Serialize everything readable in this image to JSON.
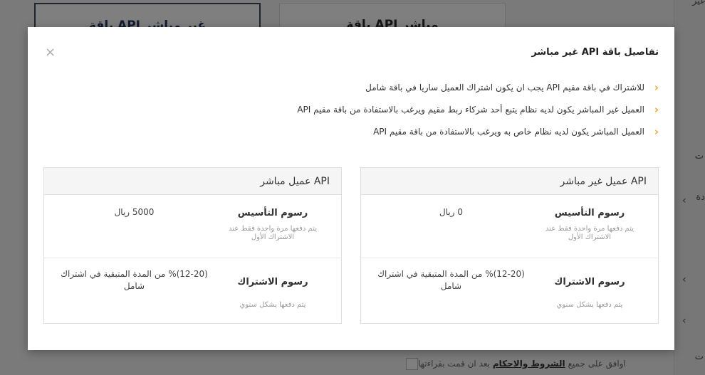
{
  "background": {
    "cards": [
      {
        "title": "باقة API غير مباشر"
      },
      {
        "title": "باقة API مباشر"
      }
    ],
    "side_texts": [
      "غير",
      "ت",
      "دة",
      "ت"
    ],
    "terms": {
      "prefix": "اوافق على جميع",
      "link": "الشروط والاحكام",
      "suffix": "بعد ان قمت بقراءتها"
    }
  },
  "modal": {
    "title": "تفاصيل باقة API غير مباشر",
    "close_label": "×",
    "notes": [
      "للاشتراك في باقة مقيم API يجب ان يكون اشتراك العميل ساريا في باقة شامل",
      "العميل غير المباشر يكون لديه نظام يتبع أحد شركاء ربط مقيم ويرغب بالاستفادة من باقة مقيم API",
      "العميل المباشر يكون لديه نظام خاص به ويرغب بالاستفادة من باقة مقيم API"
    ],
    "packages": [
      {
        "title": "API عميل غير مباشر",
        "setup": {
          "label": "رسوم التأسيس",
          "note": "يتم دفعها مرة واحدة فقط عند الاشتراك الأول",
          "value": "0 ريال"
        },
        "subscription": {
          "label": "رسوم الاشتراك",
          "note": "يتم دفعها بشكل سنوي",
          "value": "(12-20)% من المدة المتبقية في اشتراك شامل"
        }
      },
      {
        "title": "API عميل مباشر",
        "setup": {
          "label": "رسوم التأسيس",
          "note": "يتم دفعها مرة واحدة فقط عند الاشتراك الأول",
          "value": "5000 ريال"
        },
        "subscription": {
          "label": "رسوم الاشتراك",
          "note": "يتم دفعها بشكل سنوي",
          "value": "(12-20)% من المدة المتبقية في اشتراك شامل"
        }
      }
    ]
  }
}
